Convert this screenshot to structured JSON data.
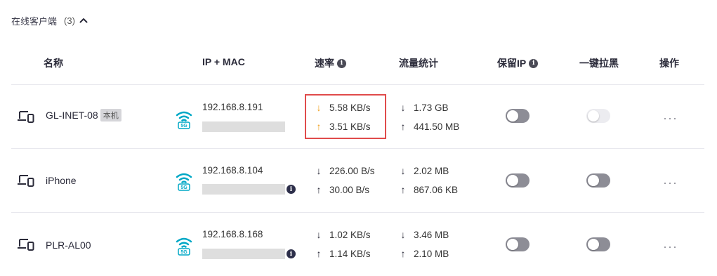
{
  "section": {
    "title": "在线客户端",
    "count": "(3)"
  },
  "columns": {
    "name": "名称",
    "ip_mac": "IP + MAC",
    "rate": "速率",
    "traffic": "流量统计",
    "reserve_ip": "保留IP",
    "block": "一键拉黑",
    "actions": "操作"
  },
  "band_label": "5G",
  "more_glyph": "···",
  "info_glyph": "i",
  "rows": [
    {
      "name": "GL-INET-08",
      "badge": "本机",
      "ip": "192.168.8.191",
      "down_rate": "5.58 KB/s",
      "up_rate": "3.51 KB/s",
      "down_total": "1.73 GB",
      "up_total": "441.50 MB",
      "reserve_ip": false,
      "block": false,
      "block_disabled": true
    },
    {
      "name": "iPhone",
      "badge": "",
      "ip": "192.168.8.104",
      "down_rate": "226.00 B/s",
      "up_rate": "30.00 B/s",
      "down_total": "2.02 MB",
      "up_total": "867.06 KB",
      "reserve_ip": false,
      "block": false,
      "block_disabled": false
    },
    {
      "name": "PLR-AL00",
      "badge": "",
      "ip": "192.168.8.168",
      "down_rate": "1.02 KB/s",
      "up_rate": "1.14 KB/s",
      "down_total": "3.46 MB",
      "up_total": "2.10 MB",
      "reserve_ip": false,
      "block": false,
      "block_disabled": false
    }
  ],
  "colors": {
    "accent": "#00a8c6",
    "upload_highlight": "#f0a020",
    "highlight_border": "#e04b4b"
  }
}
